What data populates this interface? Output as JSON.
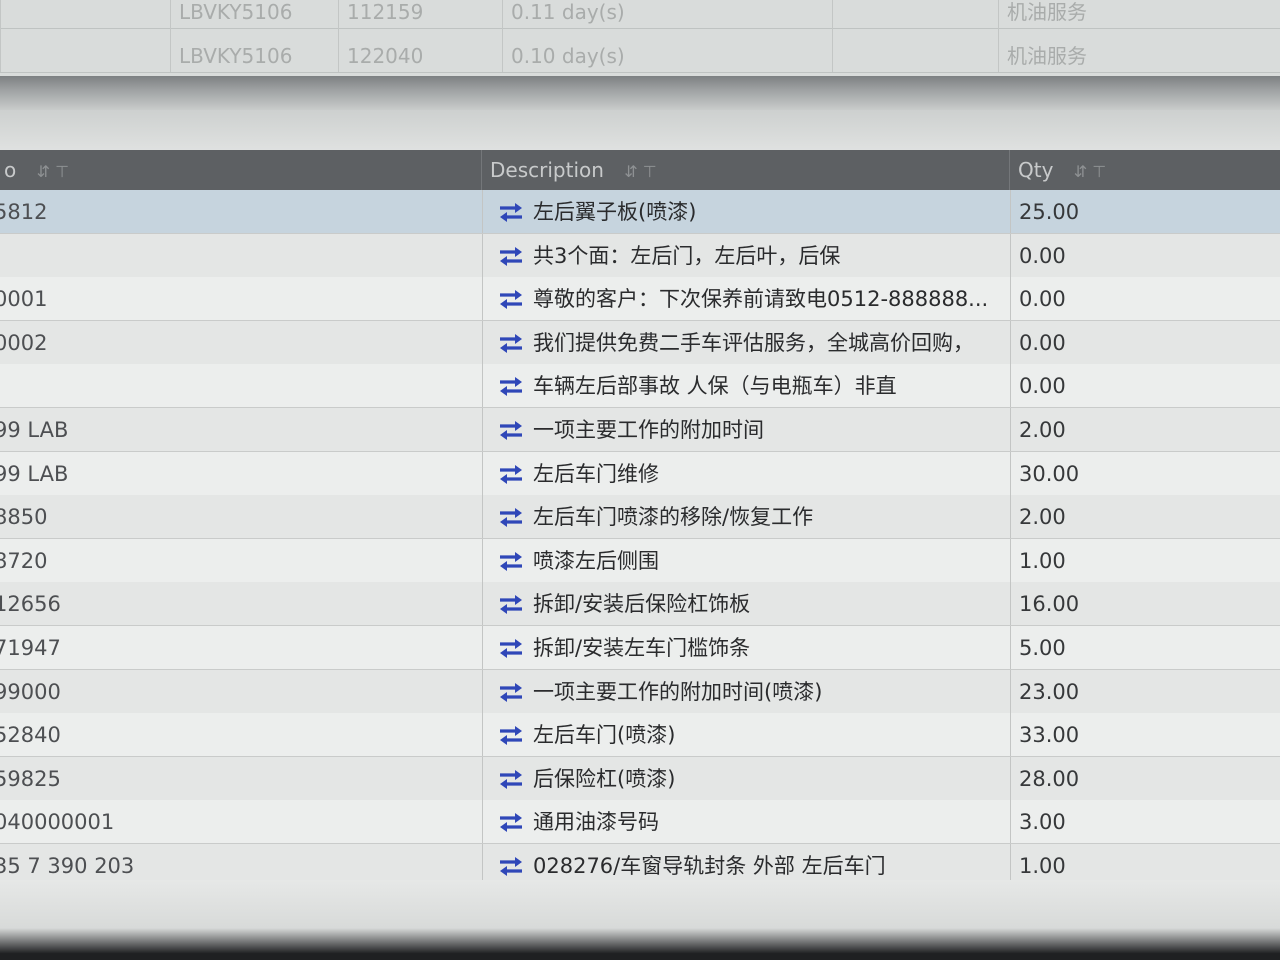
{
  "top_table": {
    "rows": [
      {
        "vin": "LBVKY5106",
        "num": "112159",
        "duration": "0.11 day(s)",
        "service": "机油服务"
      },
      {
        "vin": "LBVKY5106",
        "num": "122040",
        "duration": "0.10 day(s)",
        "service": "机油服务"
      }
    ]
  },
  "grid": {
    "headers": {
      "col1": "o",
      "col2": "Description",
      "col3": "Qty"
    },
    "rows": [
      {
        "code": "5812",
        "description": "左后翼子板(喷漆)",
        "qty": "25.00"
      },
      {
        "code": "",
        "description": "共3个面：左后门，左后叶，后保",
        "qty": "0.00"
      },
      {
        "code": "0001",
        "description": "尊敬的客户：下次保养前请致电0512-888888...",
        "qty": "0.00"
      },
      {
        "code": "0002",
        "description": "我们提供免费二手车评估服务，全城高价回购，",
        "qty": "0.00"
      },
      {
        "code": "",
        "description": "车辆左后部事故 人保（与电瓶车）非直",
        "qty": "0.00"
      },
      {
        "code": "99 LAB",
        "description": "一项主要工作的附加时间",
        "qty": "2.00"
      },
      {
        "code": "99 LAB",
        "description": "左后车门维修",
        "qty": "30.00"
      },
      {
        "code": "8850",
        "description": "左后车门喷漆的移除/恢复工作",
        "qty": "2.00"
      },
      {
        "code": "8720",
        "description": "喷漆左后侧围",
        "qty": "1.00"
      },
      {
        "code": "12656",
        "description": "拆卸/安装后保险杠饰板",
        "qty": "16.00"
      },
      {
        "code": "71947",
        "description": "拆卸/安装左车门槛饰条",
        "qty": "5.00"
      },
      {
        "code": "99000",
        "description": "一项主要工作的附加时间(喷漆)",
        "qty": "23.00"
      },
      {
        "code": "52840",
        "description": "左后车门(喷漆)",
        "qty": "33.00"
      },
      {
        "code": "59825",
        "description": "后保险杠(喷漆)",
        "qty": "28.00"
      },
      {
        "code": "040000001",
        "description": "通用油漆号码",
        "qty": "3.00"
      },
      {
        "code": "35 7 390 203",
        "description": "028276/车窗导轨封条 外部 左后车门",
        "qty": "1.00"
      }
    ]
  },
  "watermark": "",
  "colors": {
    "header_bg": "#5d6063",
    "selected_row": "#c6d4de",
    "icon_blue": "#2f47b8"
  },
  "icons": {
    "row_icon": "swap-arrows-icon",
    "sort_icon": "sort-filter-icon"
  }
}
